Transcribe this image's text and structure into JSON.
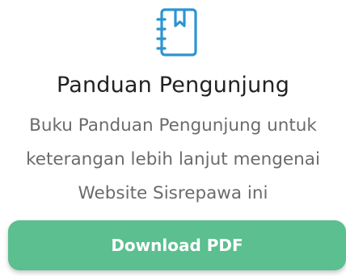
{
  "card": {
    "icon": "guide-book-icon",
    "title": "Panduan Pengunjung",
    "description_lines": [
      "Buku Panduan Pengunjung untuk",
      "keterangan lebih lanjut mengenai",
      "Website Sisrepawa ini"
    ],
    "button_label": "Download PDF"
  },
  "colors": {
    "icon": "#2e93d1",
    "title": "#222222",
    "description": "#6b6b6b",
    "button_bg": "#5bbf8f",
    "button_text": "#ffffff"
  }
}
